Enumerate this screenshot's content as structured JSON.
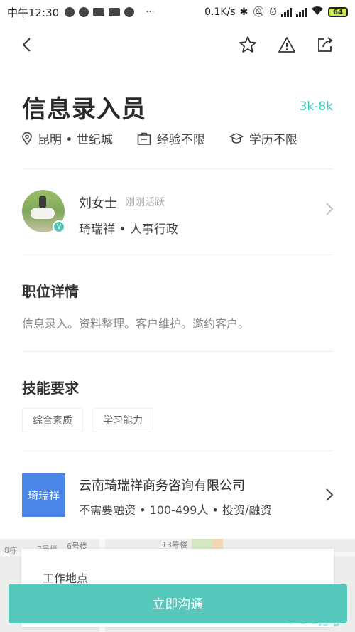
{
  "status_bar": {
    "time": "中午12:30",
    "extra": "···",
    "network_speed": "0.1K/s",
    "battery": "64"
  },
  "job": {
    "title": "信息录入员",
    "salary": "3k-8k",
    "location": "昆明 • 世纪城",
    "experience": "经验不限",
    "education": "学历不限"
  },
  "recruiter": {
    "name": "刘女士",
    "status": "刚刚活跃",
    "company_role": "琦瑞祥 • 人事行政",
    "verified_badge": "V"
  },
  "details": {
    "title": "职位详情",
    "description": "信息录入。资料整理。客户维护。邀约客户。"
  },
  "skills": {
    "title": "技能要求",
    "tags": [
      "综合素质",
      "学习能力"
    ]
  },
  "company": {
    "logo_text": "琦瑞祥",
    "name": "云南琦瑞祥商务咨询有限公司",
    "info": "不需要融资 • 100-499人 • 投资/融资"
  },
  "map": {
    "labels": [
      "8栋",
      "7号楼",
      "6号楼",
      "13号楼"
    ],
    "card_label": "工作地点"
  },
  "cta": {
    "label": "立即沟通"
  },
  "watermark": "PP助手",
  "colors": {
    "accent": "#3cc5b9",
    "cta": "#56c8bc",
    "logo_bg": "#4a86e8"
  }
}
